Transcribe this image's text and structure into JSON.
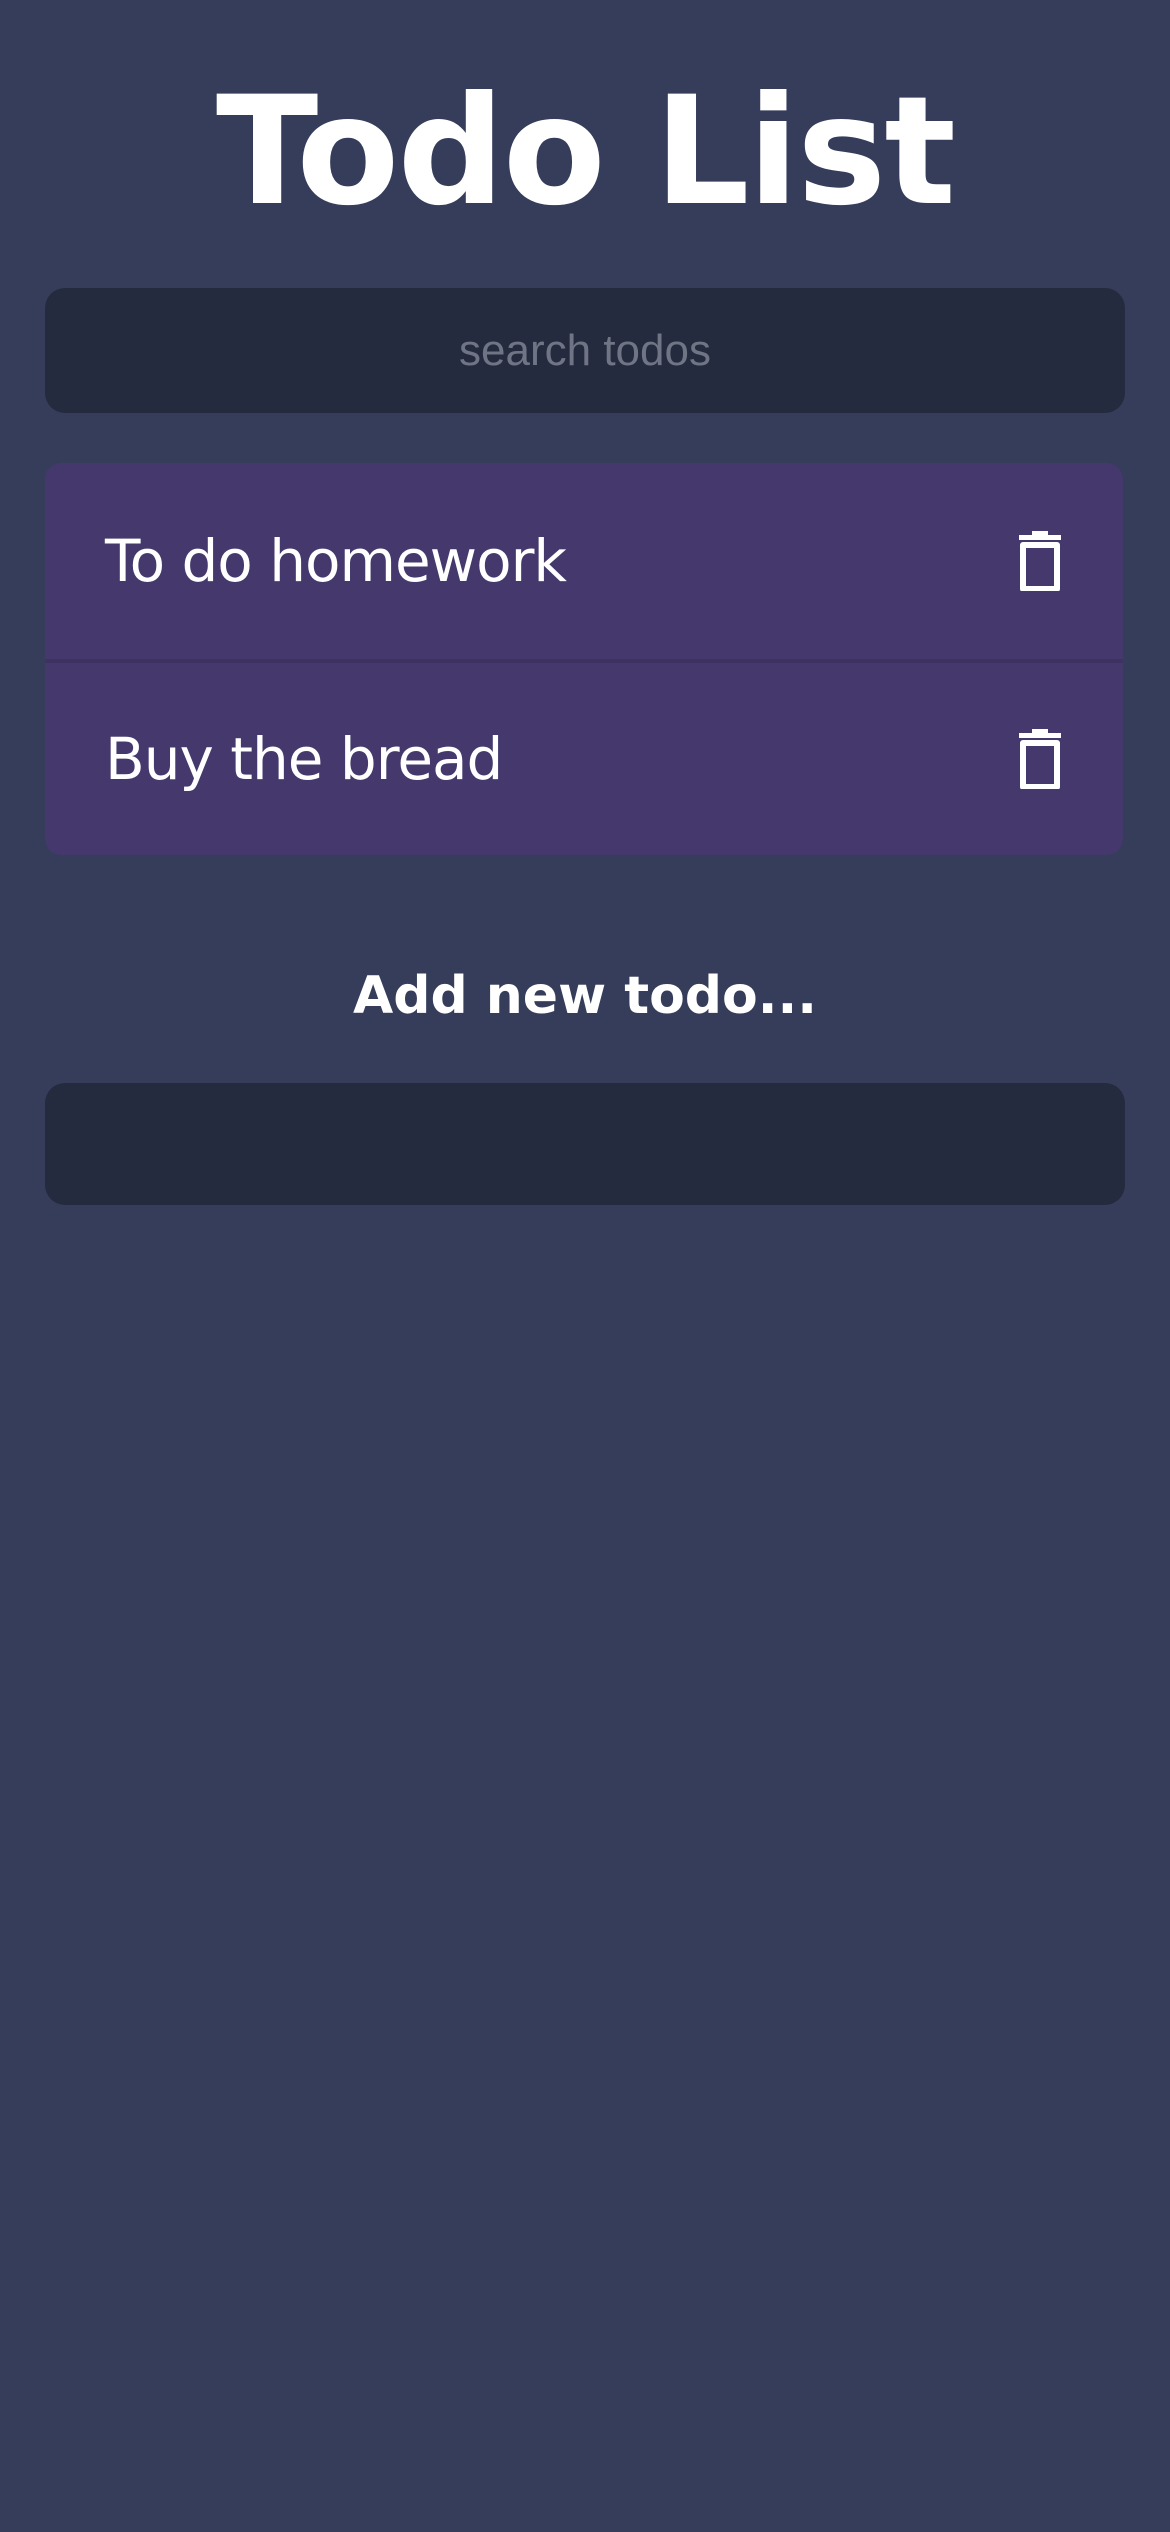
{
  "header": {
    "title": "Todo List"
  },
  "search": {
    "placeholder": "search todos",
    "value": ""
  },
  "todos": [
    {
      "text": "To do homework",
      "delete_icon": "trash-icon"
    },
    {
      "text": "Buy the bread",
      "delete_icon": "trash-icon"
    }
  ],
  "add": {
    "label": "Add new todo...",
    "value": ""
  },
  "colors": {
    "background": "#353d5a",
    "input_background": "#252b3e",
    "todo_background": "#44386d",
    "text": "#ffffff",
    "placeholder": "#6f7585"
  }
}
